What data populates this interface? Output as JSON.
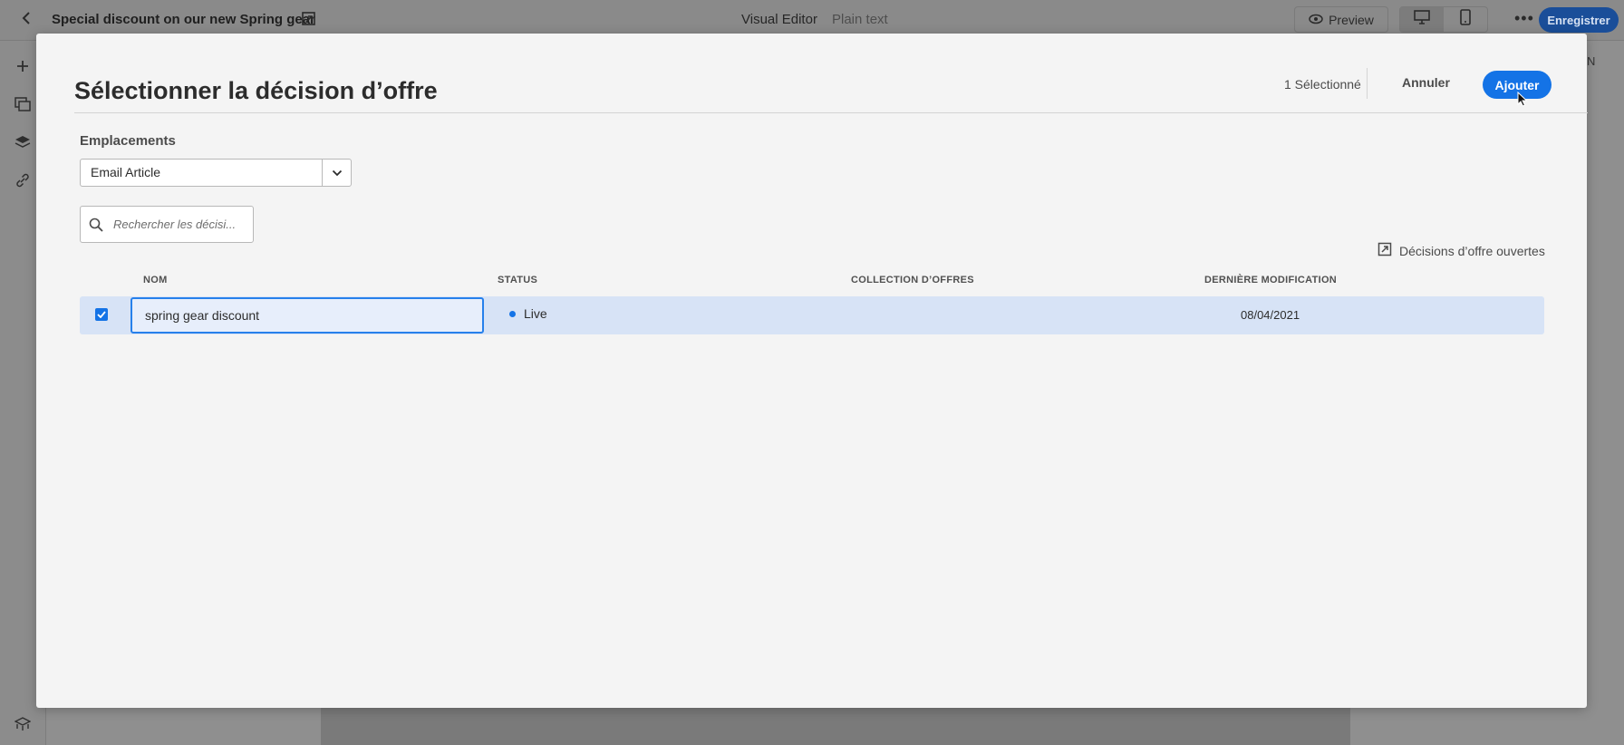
{
  "app": {
    "title": "Special discount on our new Spring gear",
    "modes": [
      "Visual Editor",
      "Plain text"
    ],
    "preview_label": "Preview",
    "save_label": "Enregistrer",
    "right_sliver": "N"
  },
  "modal": {
    "title": "Sélectionner la décision d’offre",
    "selected_count": "1 Sélectionné",
    "cancel_label": "Annuler",
    "add_label": "Ajouter",
    "locations_label": "Emplacements",
    "location_value": "Email Article",
    "search_placeholder": "Rechercher les décisi...",
    "open_link": "Décisions d’offre ouvertes",
    "columns": [
      "NOM",
      "STATUS",
      "COLLECTION D’OFFRES",
      "DERNIÈRE MODIFICATION"
    ],
    "rows": [
      {
        "name": "spring gear discount",
        "status": "Live",
        "collection": "",
        "modified": "08/04/2021",
        "selected": true
      }
    ]
  },
  "colors": {
    "accent": "#1473e6",
    "selected_row": "#d7e3f6",
    "status_live": "#1473e6"
  }
}
